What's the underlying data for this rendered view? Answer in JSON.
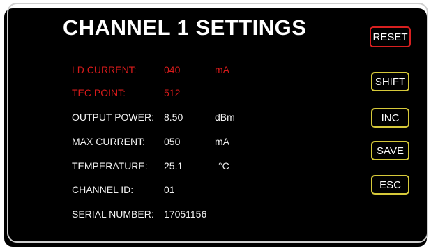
{
  "title": "CHANNEL 1 SETTINGS",
  "rows": [
    {
      "label": "LD CURRENT:",
      "value": "040",
      "unit": "mA",
      "highlight": true
    },
    {
      "label": "TEC POINT:",
      "value": "512",
      "unit": "",
      "highlight": true
    },
    {
      "label": "OUTPUT POWER:",
      "value": "8.50",
      "unit": "dBm",
      "highlight": false
    },
    {
      "label": "MAX CURRENT:",
      "value": "050",
      "unit": "mA",
      "highlight": false
    },
    {
      "label": "TEMPERATURE:",
      "value": "25.1",
      "unit": "°C",
      "highlight": false
    },
    {
      "label": "CHANNEL ID:",
      "value": "01",
      "unit": "",
      "highlight": false
    },
    {
      "label": "SERIAL NUMBER:",
      "value": "17051156",
      "unit": "",
      "highlight": false
    }
  ],
  "buttons": {
    "reset": "RESET",
    "shift": "SHIFT",
    "inc": "INC",
    "save": "SAVE",
    "esc": "ESC"
  },
  "colors": {
    "background": "#000000",
    "highlight_text": "#d81b1b",
    "normal_text": "#f2f2f2",
    "button_border": "#d6c93a",
    "reset_border": "#d82020"
  }
}
